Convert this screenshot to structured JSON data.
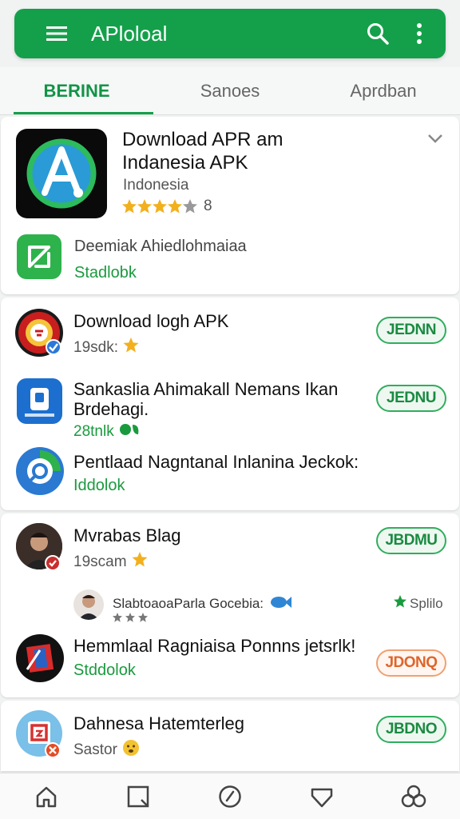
{
  "appbar": {
    "title": "APloloal",
    "color": "#14a04a"
  },
  "tabs": [
    {
      "label": "BERINE",
      "active": true
    },
    {
      "label": "Sanoes",
      "active": false
    },
    {
      "label": "Aprdban",
      "active": false
    }
  ],
  "featured": {
    "title_line1": "Download APR am",
    "title_line2": "Indanesia APK",
    "subtitle": "Indonesia",
    "rating_stars": 4,
    "rating_count": "8",
    "secondary_title": "Deemiak Ahiedlohmaiaa",
    "secondary_status": "Stadlobk"
  },
  "list1": [
    {
      "name": "Download logh APK",
      "meta": "19sdk:",
      "button": "JEDNN"
    },
    {
      "name_line1": "Sankaslia Ahimakall Nemans Ikan",
      "name_line2": "Brdehagi.",
      "meta": "28tnlk",
      "button": "JEDNU"
    },
    {
      "name": "Pentlaad Nagntanal Inlanina Jeckok:",
      "meta": "Iddolok"
    }
  ],
  "list2": [
    {
      "name": "Mvrabas Blag",
      "meta": "19scam",
      "button": "JBDMU"
    },
    {
      "comment": "SlabtoaoaParla Gocebia:",
      "status": "Splilo"
    },
    {
      "name": "Hemmlaal Ragniaisa Ponnns jetsrlk!",
      "meta": "Stddolok",
      "button": "JDONQ"
    }
  ],
  "list3": [
    {
      "name": "Dahnesa Hatemterleg",
      "meta": "Sastor",
      "button": "JBDNO"
    }
  ],
  "bottom_nav": [
    "home-icon",
    "square-icon",
    "compass-icon",
    "shield-icon",
    "group-icon"
  ]
}
